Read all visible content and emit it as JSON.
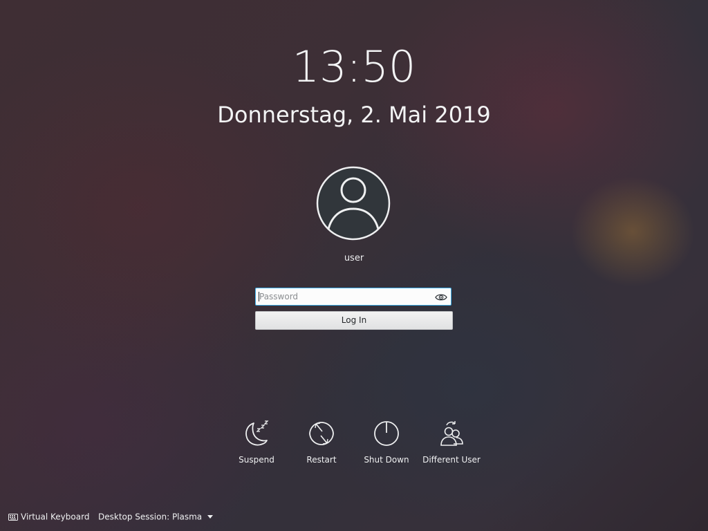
{
  "clock": {
    "time": "13:50",
    "date": "Donnerstag, 2. Mai 2019"
  },
  "user": {
    "name": "user",
    "avatar_icon": "user-avatar-icon"
  },
  "login": {
    "password_value": "",
    "password_placeholder": "Password",
    "reveal_icon": "eye-icon",
    "button_label": "Log In"
  },
  "actions": [
    {
      "label": "Suspend",
      "icon": "moon-sleep-icon"
    },
    {
      "label": "Restart",
      "icon": "restart-icon"
    },
    {
      "label": "Shut Down",
      "icon": "power-icon"
    },
    {
      "label": "Different User",
      "icon": "switch-user-icon"
    }
  ],
  "bottom": {
    "virtual_keyboard": "Virtual Keyboard",
    "keyboard_icon": "keyboard-icon",
    "session_label": "Desktop Session: Plasma"
  },
  "colors": {
    "accent": "#3daee9",
    "text": "#eff0f1",
    "avatar_bg": "#31363b"
  }
}
